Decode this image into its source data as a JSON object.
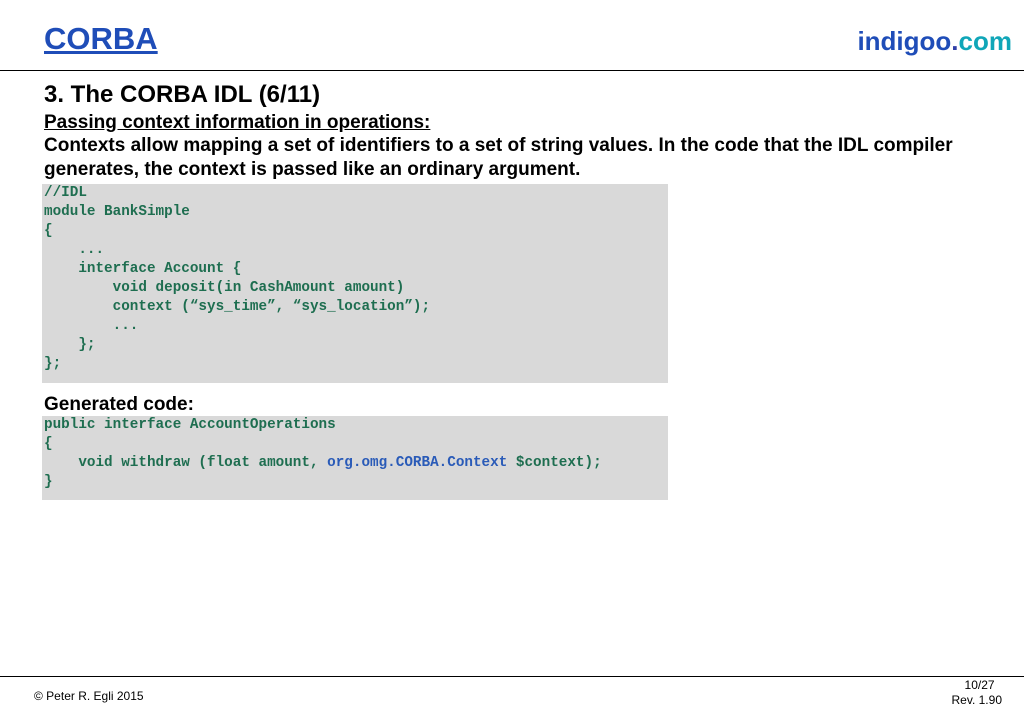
{
  "header": {
    "title": "CORBA",
    "brand_part1": "indigoo",
    "brand_dot": ".",
    "brand_part2": "com"
  },
  "slide": {
    "title": "3. The CORBA IDL (6/11)",
    "subheading": "Passing context information in operations:",
    "intro": "Contexts allow mapping a set of identifiers to a set of string values. In the code that the IDL compiler generates, the context is passed like an ordinary argument.",
    "generated_heading": "Generated code:"
  },
  "idl_code": [
    "//IDL",
    "module BankSimple",
    "{",
    "    ...",
    "    interface Account {",
    "        void deposit(in CashAmount amount)",
    "        context (“sys_time”, “sys_location”);",
    "        ...",
    "    };",
    "};"
  ],
  "generated_code": {
    "line1": "public interface AccountOperations",
    "line2": "{",
    "line3_before": "    void withdraw (float amount, ",
    "line3_highlight": "org.omg.CORBA.Context",
    "line3_after": " $context);",
    "line4": "}"
  },
  "footer": {
    "copyright": "© Peter R. Egli 2015",
    "page": "10/27",
    "revision": "Rev. 1.90"
  },
  "colors": {
    "title_blue": "#1f4db8",
    "brand_cyan": "#10a6b8",
    "code_green": "#1e6e50",
    "code_highlight": "#2a5bb8",
    "code_background": "#d9d9d9"
  }
}
